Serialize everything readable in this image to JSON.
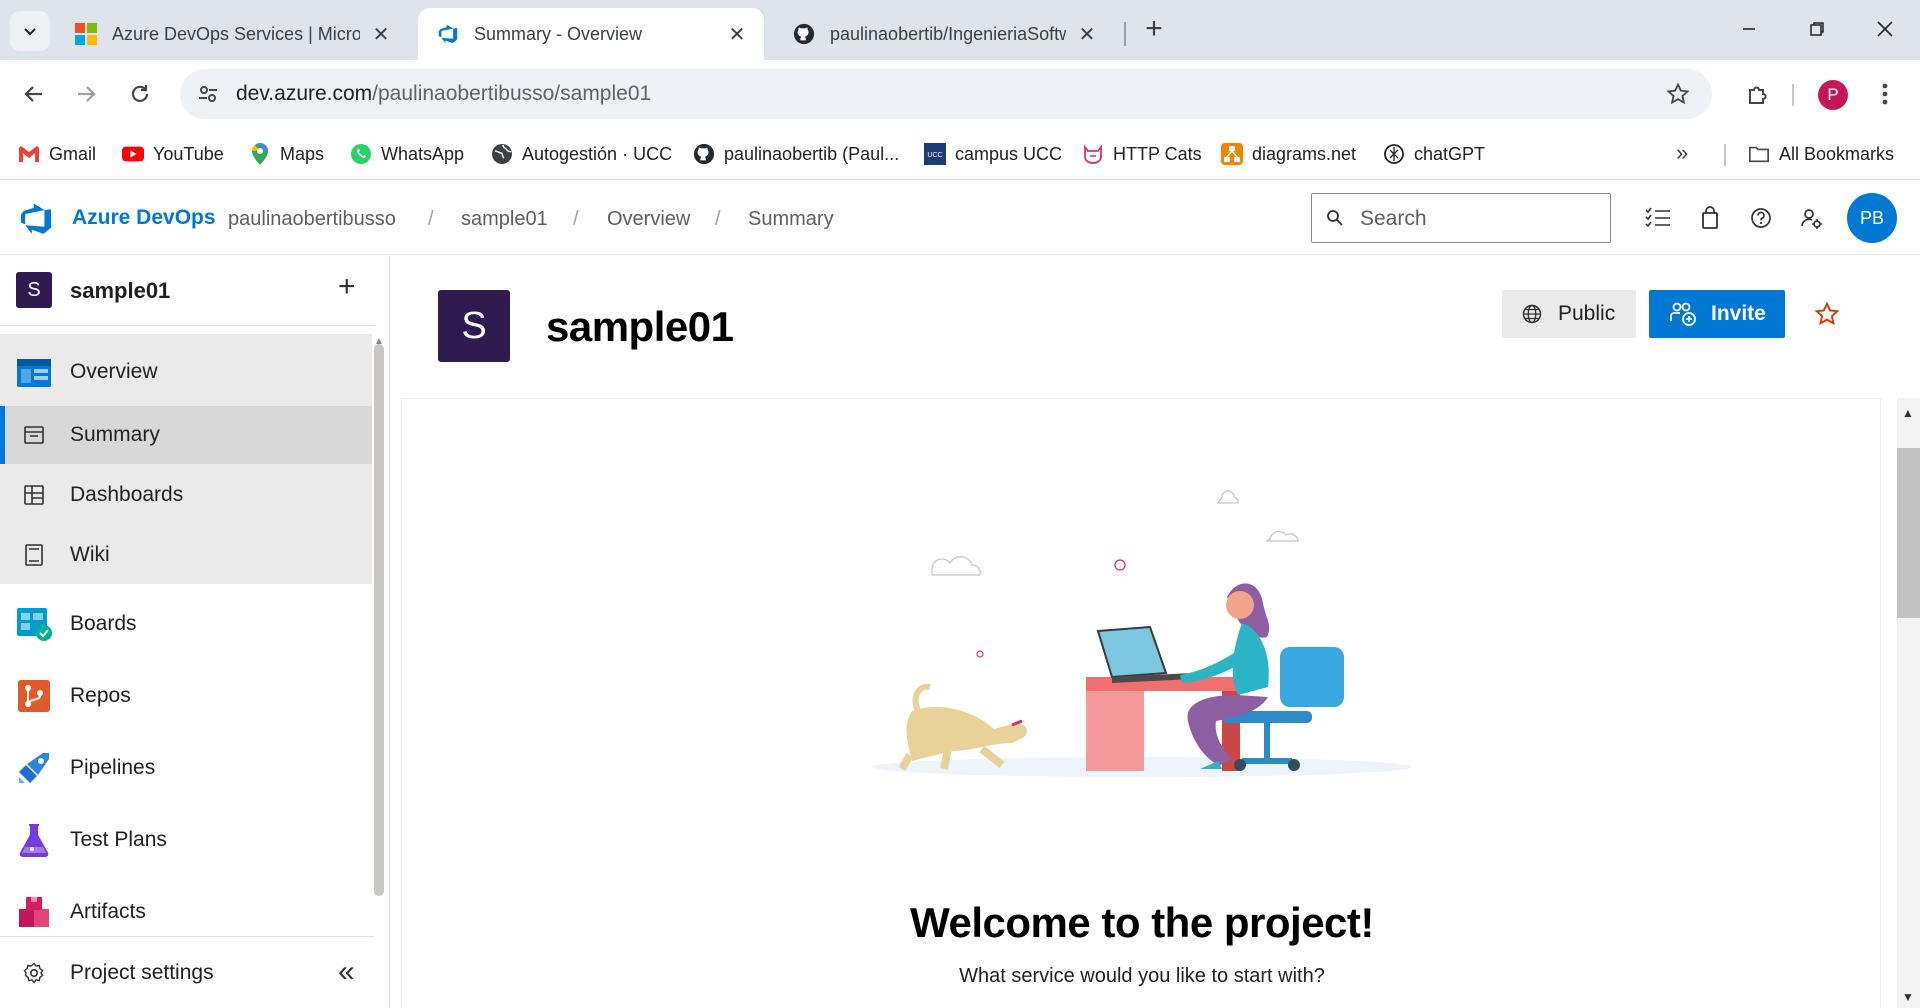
{
  "browser": {
    "tabs": [
      {
        "title": "Azure DevOps Services | Microsoft Azure",
        "active": false
      },
      {
        "title": "Summary - Overview",
        "active": true
      },
      {
        "title": "paulinaobertib/IngenieriaSoftware",
        "active": false
      }
    ],
    "url_host": "dev.azure.com",
    "url_path": "/paulinaobertibusso/sample01",
    "profile_initial": "P",
    "bookmarks": [
      {
        "label": "Gmail",
        "icon": "gmail-icon"
      },
      {
        "label": "YouTube",
        "icon": "youtube-icon"
      },
      {
        "label": "Maps",
        "icon": "maps-icon"
      },
      {
        "label": "WhatsApp",
        "icon": "whatsapp-icon"
      },
      {
        "label": "Autogestión · UCC",
        "icon": "globe-icon"
      },
      {
        "label": "paulinaobertib (Paul...",
        "icon": "github-icon"
      },
      {
        "label": "campus UCC",
        "icon": "ucc-icon"
      },
      {
        "label": "HTTP Cats",
        "icon": "cat-icon"
      },
      {
        "label": "diagrams.net",
        "icon": "drawio-icon"
      },
      {
        "label": "chatGPT",
        "icon": "openai-icon"
      }
    ],
    "all_bookmarks": "All Bookmarks"
  },
  "header": {
    "brand": "Azure DevOps",
    "breadcrumb": [
      "paulinaobertibusso",
      "sample01",
      "Overview",
      "Summary"
    ],
    "search_placeholder": "Search",
    "avatar_initials": "PB"
  },
  "sidebar": {
    "project_initial": "S",
    "project_name": "sample01",
    "items": [
      {
        "label": "Overview",
        "icon": "overview-icon"
      },
      {
        "label": "Summary",
        "icon": "summary-icon",
        "selected": true
      },
      {
        "label": "Dashboards",
        "icon": "dashboards-icon"
      },
      {
        "label": "Wiki",
        "icon": "wiki-icon"
      },
      {
        "label": "Boards",
        "icon": "boards-icon"
      },
      {
        "label": "Repos",
        "icon": "repos-icon"
      },
      {
        "label": "Pipelines",
        "icon": "pipelines-icon"
      },
      {
        "label": "Test Plans",
        "icon": "test-plans-icon"
      },
      {
        "label": "Artifacts",
        "icon": "artifacts-icon"
      }
    ],
    "settings": "Project settings"
  },
  "main": {
    "project_initial": "S",
    "project_title": "sample01",
    "public_label": "Public",
    "invite_label": "Invite",
    "welcome_title": "Welcome to the project!",
    "welcome_subtitle": "What service would you like to start with?"
  },
  "colors": {
    "accent": "#0078d4",
    "project_tile": "#2e1a4f",
    "tabstrip": "#dfe3eb"
  }
}
